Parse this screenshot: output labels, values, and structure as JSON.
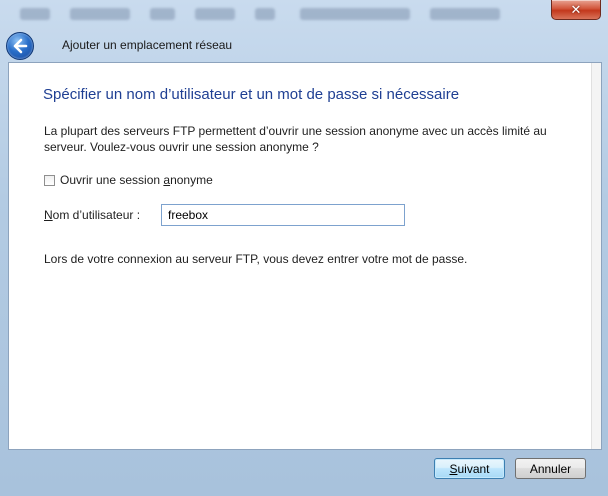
{
  "titlebar": {
    "close_glyph": "✕"
  },
  "nav": {
    "back_icon": "arrow-left-icon",
    "title": "Ajouter un emplacement réseau"
  },
  "main": {
    "heading": "Spécifier un nom d’utilisateur et un mot de passe si nécessaire",
    "intro": "La plupart des serveurs FTP permettent d’ouvrir une session anonyme avec un accès limité au serveur. Voulez-vous ouvrir une session anonyme ?",
    "anonymous": {
      "label_before": "Ouvrir une session ",
      "label_accel": "a",
      "label_after": "nonyme",
      "checked": false
    },
    "username": {
      "label_accel": "N",
      "label_rest": "om d’utilisateur :",
      "value": "freebox",
      "placeholder": ""
    },
    "footnote": "Lors de votre connexion au serveur FTP, vous devez entrer votre mot de passe."
  },
  "buttons": {
    "next_accel": "S",
    "next_rest": "uivant",
    "cancel": "Annuler"
  },
  "colors": {
    "heading": "#1f3f93",
    "close": "#c3381c",
    "default_button_border": "#3c7fb1"
  }
}
